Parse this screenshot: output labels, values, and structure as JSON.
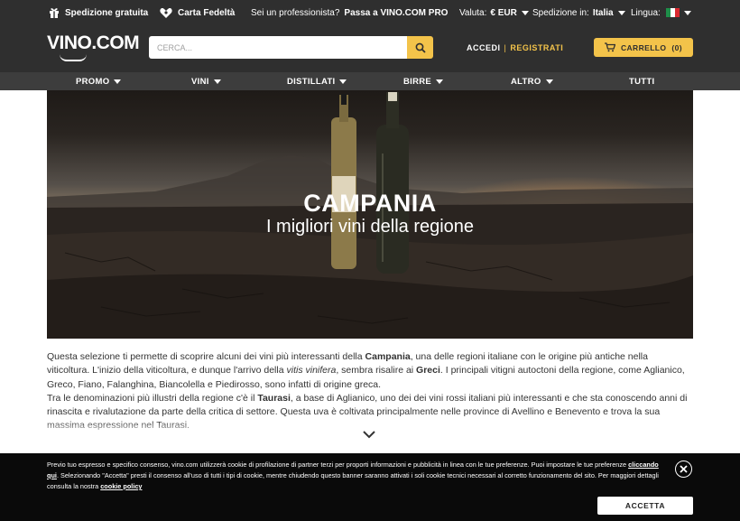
{
  "topbar": {
    "shipping": "Spedizione gratuita",
    "loyalty": "Carta Fedeltà",
    "pro_question": "Sei un professionista?",
    "pro_link": "Passa a VINO.COM PRO",
    "currency_label": "Valuta:",
    "currency_value": "€ EUR",
    "ship_label": "Spedizione in:",
    "ship_value": "Italia",
    "lang_label": "Lingua:"
  },
  "header": {
    "logo": "VINO.COM",
    "search_placeholder": "CERCA...",
    "login": "ACCEDI",
    "separator": "|",
    "register": "REGISTRATI",
    "cart_label": "CARRELLO",
    "cart_count": "(0)"
  },
  "nav": {
    "promo": "PROMO",
    "vini": "VINI",
    "distillati": "DISTILLATI",
    "birre": "BIRRE",
    "altro": "ALTRO",
    "tutti": "TUTTI"
  },
  "hero": {
    "title": "CAMPANIA",
    "subtitle": "I migliori vini della regione"
  },
  "description": {
    "p1_a": "Questa selezione ti permette di scoprire alcuni dei vini più interessanti della ",
    "p1_b": "Campania",
    "p1_c": ", una delle regioni italiane con le origine più antiche nella viticoltura. L'inizio della viticoltura, e dunque l'arrivo della ",
    "p1_d": "vitis vinifera",
    "p1_e": ", sembra risalire ai ",
    "p1_f": "Greci",
    "p1_g": ". I principali vitigni autoctoni della regione, come Aglianico, Greco, Fiano, Falanghina, Biancolella e Piedirosso, sono infatti di origine greca.",
    "p2_a": "Tra le denominazioni più illustri della regione c'è il ",
    "p2_b": "Taurasi",
    "p2_c": ", a base di Aglianico, uno dei dei vini rossi italiani più interessanti e che sta conoscendo anni di rinascita e rivalutazione da parte della critica di settore. Questa uva è coltivata principalmente nelle province di Avellino e Benevento e trova la",
    "p2_d": " sua massima espressione nel Taurasi."
  },
  "cookie": {
    "text_a": "Previo tuo espresso e specifico consenso, vino.com utilizzerà cookie di profilazione di partner terzi per proporti informazioni e pubblicità in linea con le tue preferenze. Puoi impostare le tue preferenze ",
    "link1": "cliccando qui",
    "text_b": ". Selezionando \"Accetta\" presti il consenso all'uso di tutti i tipi di cookie, mentre chiudendo questo banner saranno attivati i soli cookie tecnici necessari al corretto funzionamento del sito. Per maggiori dettagli consulta la nostra ",
    "link2": "cookie policy",
    "accept": "ACCETTA"
  },
  "colors": {
    "dark": "#2f2f2f",
    "accent": "#f3c34a",
    "cookie_bg": "#0a0a0a"
  },
  "icons": [
    "gift-icon",
    "loyalty-card-icon",
    "flag-italy-icon",
    "search-icon",
    "cart-icon",
    "close-icon",
    "chevron-down-icon"
  ]
}
